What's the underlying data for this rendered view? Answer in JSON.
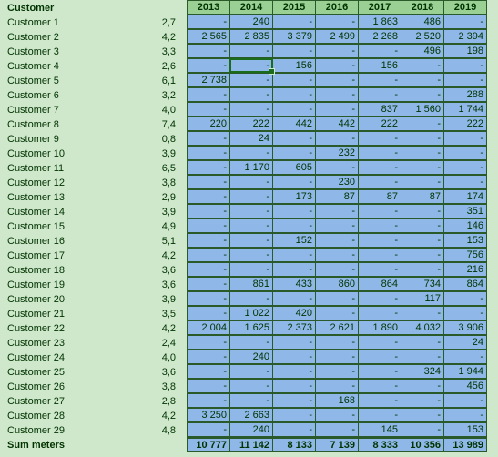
{
  "headerLabel": "Customer",
  "years": [
    "2013",
    "2014",
    "2015",
    "2016",
    "2017",
    "2018",
    "2019"
  ],
  "customers": [
    {
      "name": "Customer 1",
      "v": "2,7",
      "cells": [
        "-",
        "240",
        "-",
        "-",
        "1 863",
        "486",
        "-"
      ]
    },
    {
      "name": "Customer 2",
      "v": "4,2",
      "cells": [
        "2 565",
        "2 835",
        "3 379",
        "2 499",
        "2 268",
        "2 520",
        "2 394"
      ]
    },
    {
      "name": "Customer 3",
      "v": "3,3",
      "cells": [
        "-",
        "-",
        "-",
        "-",
        "-",
        "496",
        "198"
      ]
    },
    {
      "name": "Customer 4",
      "v": "2,6",
      "cells": [
        "-",
        "-",
        "156",
        "-",
        "156",
        "-",
        "-"
      ]
    },
    {
      "name": "Customer 5",
      "v": "6,1",
      "cells": [
        "2 738",
        "-",
        "-",
        "-",
        "-",
        "-",
        "-"
      ]
    },
    {
      "name": "Customer 6",
      "v": "3,2",
      "cells": [
        "-",
        "-",
        "-",
        "-",
        "-",
        "-",
        "288"
      ]
    },
    {
      "name": "Customer 7",
      "v": "4,0",
      "cells": [
        "-",
        "-",
        "-",
        "-",
        "837",
        "1 560",
        "1 744"
      ]
    },
    {
      "name": "Customer 8",
      "v": "7,4",
      "cells": [
        "220",
        "222",
        "442",
        "442",
        "222",
        "-",
        "222"
      ]
    },
    {
      "name": "Customer 9",
      "v": "0,8",
      "cells": [
        "-",
        "24",
        "-",
        "-",
        "-",
        "-",
        "-"
      ]
    },
    {
      "name": "Customer 10",
      "v": "3,9",
      "cells": [
        "-",
        "-",
        "-",
        "232",
        "-",
        "-",
        "-"
      ]
    },
    {
      "name": "Customer 11",
      "v": "6,5",
      "cells": [
        "-",
        "1 170",
        "605",
        "-",
        "-",
        "-",
        "-"
      ]
    },
    {
      "name": "Customer 12",
      "v": "3,8",
      "cells": [
        "-",
        "-",
        "-",
        "230",
        "-",
        "-",
        "-"
      ]
    },
    {
      "name": "Customer 13",
      "v": "2,9",
      "cells": [
        "-",
        "-",
        "173",
        "87",
        "87",
        "87",
        "174"
      ]
    },
    {
      "name": "Customer 14",
      "v": "3,9",
      "cells": [
        "-",
        "-",
        "-",
        "-",
        "-",
        "-",
        "351"
      ]
    },
    {
      "name": "Customer 15",
      "v": "4,9",
      "cells": [
        "-",
        "-",
        "-",
        "-",
        "-",
        "-",
        "146"
      ]
    },
    {
      "name": "Customer 16",
      "v": "5,1",
      "cells": [
        "-",
        "-",
        "152",
        "-",
        "-",
        "-",
        "153"
      ]
    },
    {
      "name": "Customer 17",
      "v": "4,2",
      "cells": [
        "-",
        "-",
        "-",
        "-",
        "-",
        "-",
        "756"
      ]
    },
    {
      "name": "Customer 18",
      "v": "3,6",
      "cells": [
        "-",
        "-",
        "-",
        "-",
        "-",
        "-",
        "216"
      ]
    },
    {
      "name": "Customer 19",
      "v": "3,6",
      "cells": [
        "-",
        "861",
        "433",
        "860",
        "864",
        "734",
        "864"
      ]
    },
    {
      "name": "Customer 20",
      "v": "3,9",
      "cells": [
        "-",
        "-",
        "-",
        "-",
        "-",
        "117",
        "-"
      ]
    },
    {
      "name": "Customer 21",
      "v": "3,5",
      "cells": [
        "-",
        "1 022",
        "420",
        "-",
        "-",
        "-",
        "-"
      ]
    },
    {
      "name": "Customer 22",
      "v": "4,2",
      "cells": [
        "2 004",
        "1 625",
        "2 373",
        "2 621",
        "1 890",
        "4 032",
        "3 906"
      ]
    },
    {
      "name": "Customer 23",
      "v": "2,4",
      "cells": [
        "-",
        "-",
        "-",
        "-",
        "-",
        "-",
        "24"
      ]
    },
    {
      "name": "Customer 24",
      "v": "4,0",
      "cells": [
        "-",
        "240",
        "-",
        "-",
        "-",
        "-",
        "-"
      ]
    },
    {
      "name": "Customer 25",
      "v": "3,6",
      "cells": [
        "-",
        "-",
        "-",
        "-",
        "-",
        "324",
        "1 944"
      ]
    },
    {
      "name": "Customer 26",
      "v": "3,8",
      "cells": [
        "-",
        "-",
        "-",
        "-",
        "-",
        "-",
        "456"
      ]
    },
    {
      "name": "Customer 27",
      "v": "2,8",
      "cells": [
        "-",
        "-",
        "-",
        "168",
        "-",
        "-",
        "-"
      ]
    },
    {
      "name": "Customer 28",
      "v": "4,2",
      "cells": [
        "3 250",
        "2 663",
        "-",
        "-",
        "-",
        "-",
        "-"
      ]
    },
    {
      "name": "Customer 29",
      "v": "4,8",
      "cells": [
        "-",
        "240",
        "-",
        "-",
        "145",
        "-",
        "153"
      ]
    }
  ],
  "sumLabel": "Sum meters",
  "sumCells": [
    "10 777",
    "11 142",
    "8 133",
    "7 139",
    "8 333",
    "10 356",
    "13 989"
  ],
  "selectedCell": {
    "row": 3,
    "col": 1
  }
}
